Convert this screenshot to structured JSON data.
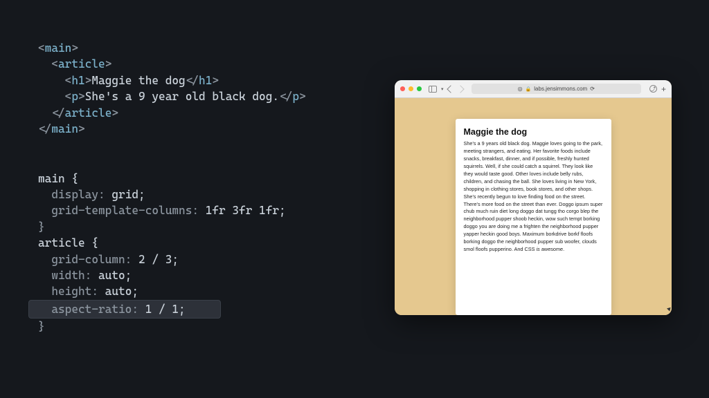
{
  "html_code": {
    "main_open": "main",
    "article_open": "article",
    "h1_open": "h1",
    "h1_text": "Maggie the dog",
    "h1_close": "/h1",
    "p_open": "p",
    "p_text": "She's a 9 year old black dog.",
    "p_close": "/p",
    "article_close": "/article",
    "main_close": "/main"
  },
  "css_code": {
    "sel1": "main {",
    "p1a": "  display:",
    "p1b": " grid;",
    "p2a": "  grid-template-columns:",
    "p2b": " 1fr 3fr 1fr;",
    "close1": "}",
    "sel2": "article {",
    "p3a": "  grid-column:",
    "p3b": " 2 / 3;",
    "p4a": "  width:",
    "p4b": " auto;",
    "p5a": "  height:",
    "p5b": " auto;",
    "p6a": "  aspect-ratio:",
    "p6b": " 1 / 1;",
    "close2": "}"
  },
  "browser": {
    "url_domain": "labs.jensimmons.com"
  },
  "article": {
    "title": "Maggie the dog",
    "body_pre": "She's a 9 years old black dog. Maggie loves going to the park, meeting strangers, and eating. Her favorite foods include snacks, breakfast, dinner, and if possible, freshly hunted squirrels. Well, if she could catch a squirrel. They look like they would taste good. Other loves include belly rubs, children, and chasing the ball. She loves living in New York, shopping in clothing stores, book stores, and other shops. She's recently begun to love finding food on the street. There's more food on the street than ever. Doggo ipsum super chub much ruin diet long doggo dat tungg tho corgo blep the neighborhood pupper shoob heckin, wow such tempt borking doggo you are doing me a frighten the neighborhood pupper yapper heckin good boys. Maximum borkdrive borkf floofs borking doggo the neighborhood pupper sub woofer, clouds smol floofs pupperino. And CSS ",
    "body_ital": "is",
    "body_post": " awesome."
  }
}
